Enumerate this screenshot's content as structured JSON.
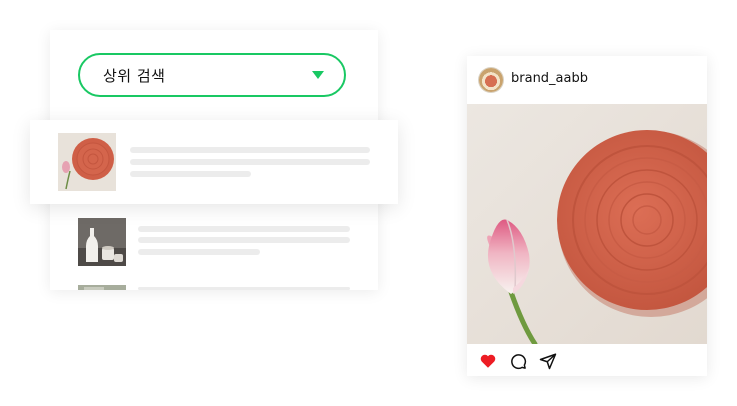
{
  "search": {
    "dropdown_label": "상위 검색"
  },
  "post": {
    "username": "brand_aabb"
  },
  "colors": {
    "accent": "#19c863",
    "like": "#ed1c24",
    "plate": "#d4654c"
  },
  "icons": {
    "dropdown": "chevron-down-icon",
    "like": "heart-icon",
    "comment": "comment-icon",
    "share": "send-icon"
  }
}
